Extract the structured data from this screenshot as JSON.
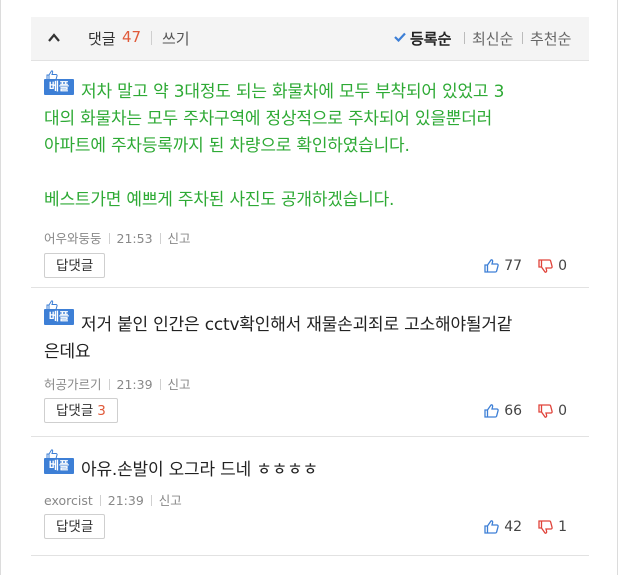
{
  "header": {
    "comments_label": "댓글",
    "comments_count": "47",
    "write_label": "쓰기",
    "sort_options": [
      {
        "label": "등록순",
        "active": true
      },
      {
        "label": "최신순",
        "active": false
      },
      {
        "label": "추천순",
        "active": false
      }
    ]
  },
  "colors": {
    "accent": "#3d7fd6",
    "best_text": "#2eaa35",
    "count": "#e05a3a",
    "down_icon": "#e0433a"
  },
  "comments": [
    {
      "badge": "베플",
      "lines": [
        "저차 말고 약 3대정도 되는 화물차에 모두 부착되어 있었고 3",
        "대의 화물차는 모두 주차구역에 정상적으로 주차되어 있을뿐더러",
        "아파트에 주차등록까지 된 차량으로 확인하였습니다.",
        "",
        "베스트가면 예쁘게 주차된 사진도 공개하겠습니다."
      ],
      "author": "어우와둥둥",
      "time": "21:53",
      "report": "신고",
      "reply_label": "답댓글",
      "reply_count": "",
      "up": "77",
      "down": "0"
    },
    {
      "badge": "베플",
      "lines": [
        "저거 붙인 인간은 cctv확인해서 재물손괴죄로 고소해야될거같",
        "은데요"
      ],
      "author": "허공가르기",
      "time": "21:39",
      "report": "신고",
      "reply_label": "답댓글",
      "reply_count": "3",
      "up": "66",
      "down": "0"
    },
    {
      "badge": "베플",
      "lines": [
        "아유.손발이 오그라 드네 ㅎㅎㅎㅎ"
      ],
      "author": "exorcist",
      "time": "21:39",
      "report": "신고",
      "reply_label": "답댓글",
      "reply_count": "",
      "up": "42",
      "down": "1"
    }
  ]
}
